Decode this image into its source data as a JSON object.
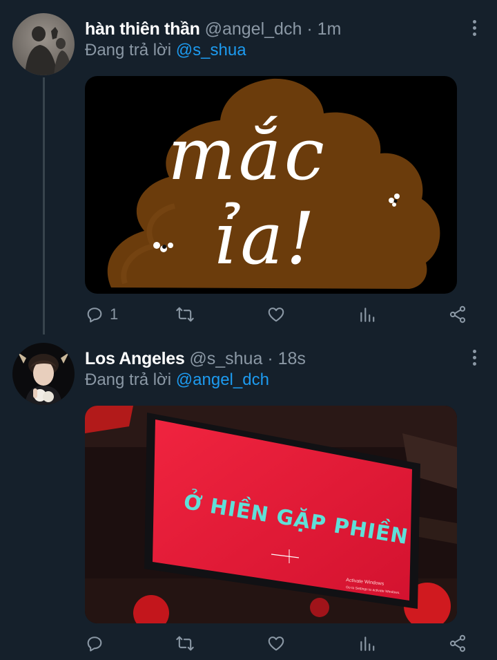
{
  "tweets": [
    {
      "name": "hàn thiên thần",
      "handle": "@angel_dch",
      "separator": "·",
      "time": "1m",
      "reply_prefix": "Đang trả lời",
      "reply_to": "@s_shua",
      "media_text_line1": "mắc",
      "media_text_line2": "ỉa!",
      "reply_count": "1"
    },
    {
      "name": "Los Angeles",
      "handle": "@s_shua",
      "separator": "·",
      "time": "18s",
      "reply_prefix": "Đang trả lời",
      "reply_to": "@angel_dch",
      "media_text": "Ở HIỀN GẶP PHIỀN",
      "activate_title": "Activate Windows",
      "activate_sub": "Go to Settings to activate Windows."
    }
  ],
  "icons": {
    "reply": "reply-icon",
    "retweet": "retweet-icon",
    "like": "heart-icon",
    "analytics": "analytics-icon",
    "share": "share-icon",
    "more": "more-icon"
  },
  "colors": {
    "background": "#15202b",
    "text": "#e7e9ea",
    "secondary": "#8b98a5",
    "link": "#1d9bf0"
  }
}
